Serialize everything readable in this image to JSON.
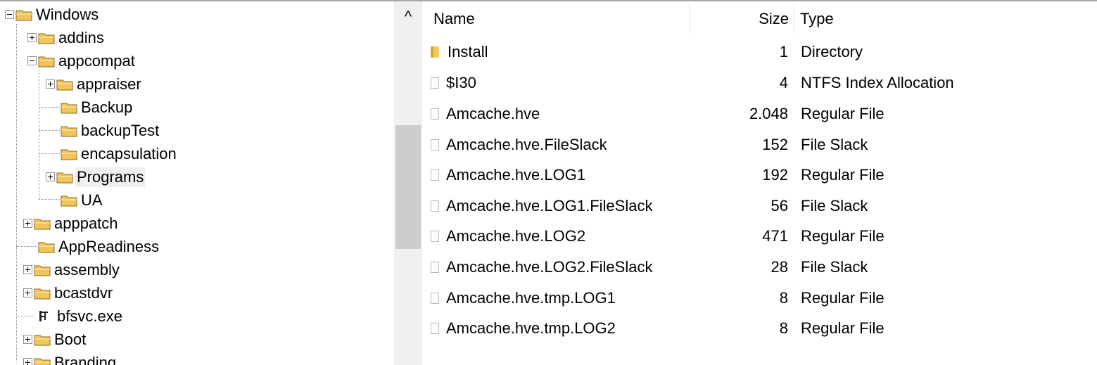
{
  "tree": {
    "nodes": [
      {
        "label": "Windows",
        "expander": "minus",
        "icon": "folder-icon"
      },
      {
        "label": "addins",
        "expander": "plus",
        "icon": "folder-icon"
      },
      {
        "label": "appcompat",
        "expander": "minus",
        "icon": "folder-icon"
      },
      {
        "label": "appraiser",
        "expander": "plus",
        "icon": "folder-icon"
      },
      {
        "label": "Backup",
        "expander": "none",
        "icon": "folder-icon"
      },
      {
        "label": "backupTest",
        "expander": "none",
        "icon": "folder-icon"
      },
      {
        "label": "encapsulation",
        "expander": "none",
        "icon": "folder-icon"
      },
      {
        "label": "Programs",
        "expander": "plus",
        "icon": "folder-icon",
        "selected": true
      },
      {
        "label": "UA",
        "expander": "none",
        "icon": "folder-icon"
      },
      {
        "label": "apppatch",
        "expander": "plus",
        "icon": "folder-icon"
      },
      {
        "label": "AppReadiness",
        "expander": "none",
        "icon": "folder-icon"
      },
      {
        "label": "assembly",
        "expander": "plus",
        "icon": "folder-icon"
      },
      {
        "label": "bcastdvr",
        "expander": "plus",
        "icon": "folder-icon"
      },
      {
        "label": "bfsvc.exe",
        "expander": "none",
        "icon": "executable-icon"
      },
      {
        "label": "Boot",
        "expander": "plus",
        "icon": "folder-icon"
      },
      {
        "label": "Branding",
        "expander": "plus",
        "icon": "folder-icon"
      }
    ]
  },
  "scrollbar": {
    "up_arrow": "^"
  },
  "list": {
    "columns": {
      "name": "Name",
      "size": "Size",
      "type": "Type"
    },
    "rows": [
      {
        "name": "Install",
        "size": "1",
        "type": "Directory",
        "icon": "directory-icon"
      },
      {
        "name": "$I30",
        "size": "4",
        "type": "NTFS Index Allocation",
        "icon": "file-icon"
      },
      {
        "name": "Amcache.hve",
        "size": "2.048",
        "type": "Regular File",
        "icon": "file-icon"
      },
      {
        "name": "Amcache.hve.FileSlack",
        "size": "152",
        "type": "File Slack",
        "icon": "file-icon"
      },
      {
        "name": "Amcache.hve.LOG1",
        "size": "192",
        "type": "Regular File",
        "icon": "file-icon"
      },
      {
        "name": "Amcache.hve.LOG1.FileSlack",
        "size": "56",
        "type": "File Slack",
        "icon": "file-icon"
      },
      {
        "name": "Amcache.hve.LOG2",
        "size": "471",
        "type": "Regular File",
        "icon": "file-icon"
      },
      {
        "name": "Amcache.hve.LOG2.FileSlack",
        "size": "28",
        "type": "File Slack",
        "icon": "file-icon"
      },
      {
        "name": "Amcache.hve.tmp.LOG1",
        "size": "8",
        "type": "Regular File",
        "icon": "file-icon"
      },
      {
        "name": "Amcache.hve.tmp.LOG2",
        "size": "8",
        "type": "Regular File",
        "icon": "file-icon"
      }
    ]
  },
  "colors": {
    "folder": "#f2c45a",
    "selection": "#efefef",
    "scroll_thumb": "#cdcdcd"
  }
}
